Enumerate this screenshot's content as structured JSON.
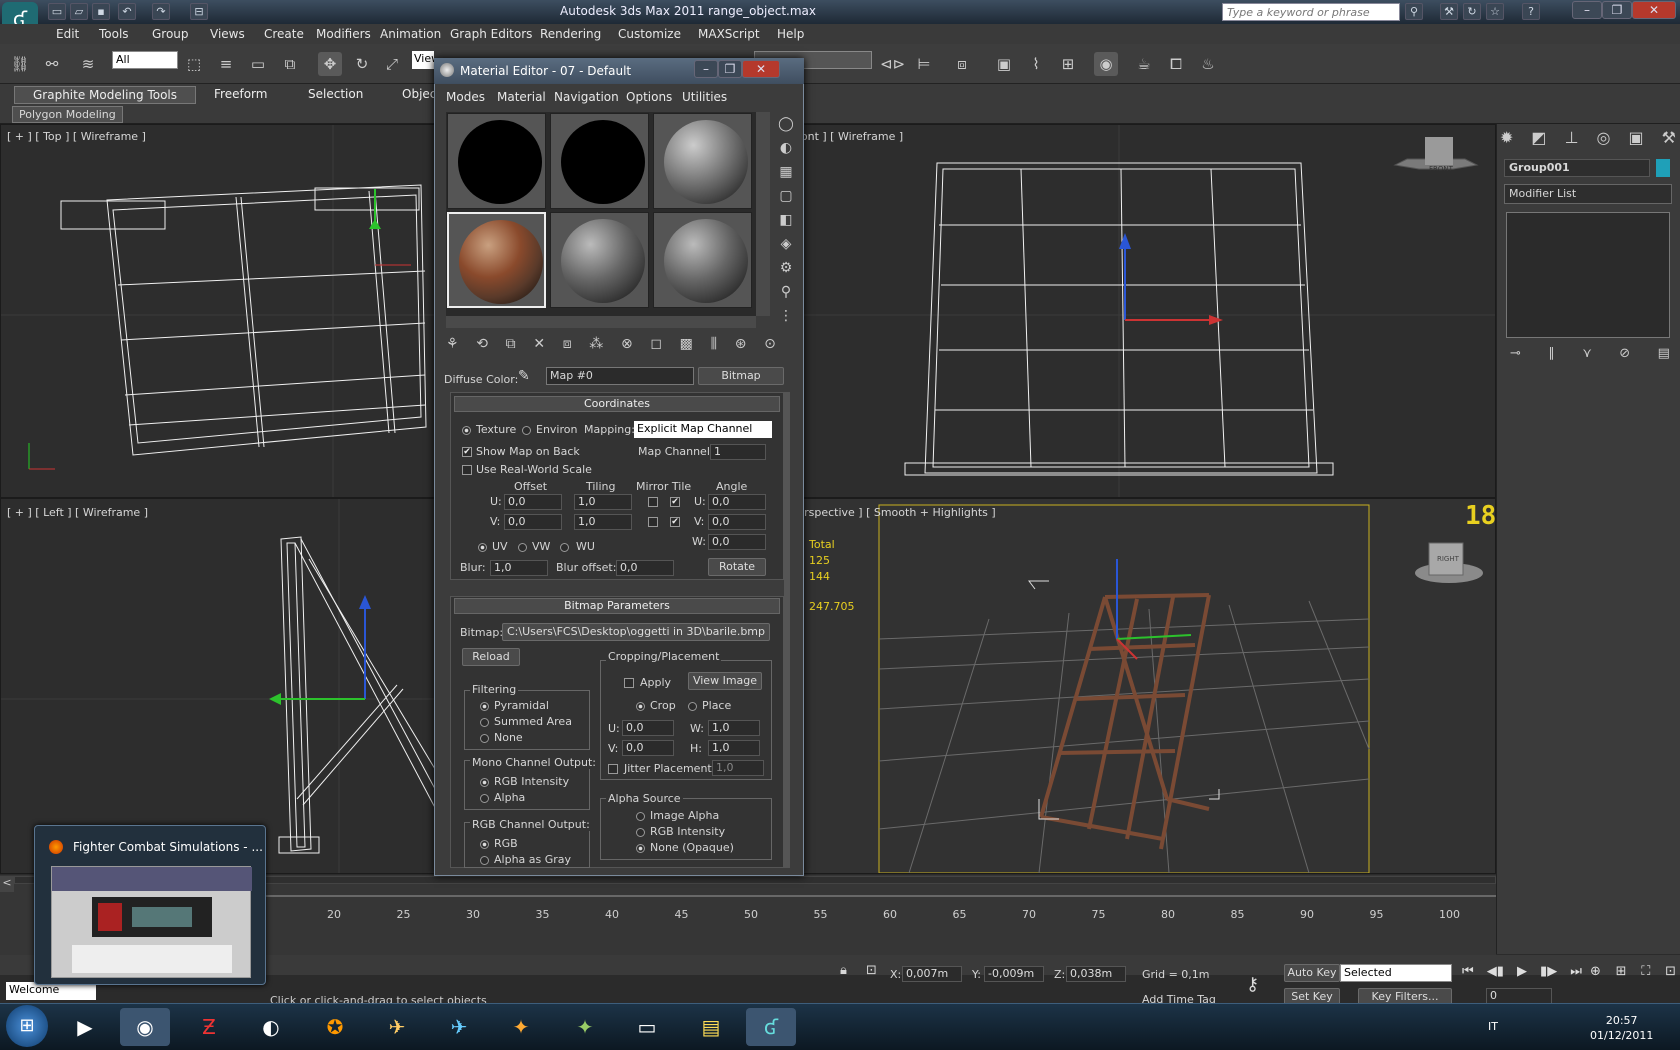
{
  "window": {
    "title": "Autodesk 3ds Max  2011      range_object.max",
    "search_placeholder": "Type a keyword or phrase"
  },
  "menubar": [
    "Edit",
    "Tools",
    "Group",
    "Views",
    "Create",
    "Modifiers",
    "Animation",
    "Graph Editors",
    "Rendering",
    "Customize",
    "MAXScript",
    "Help"
  ],
  "toolbar": {
    "selection_filter": "All",
    "view": "View"
  },
  "ribbon": {
    "tabs": [
      "Graphite Modeling Tools",
      "Freeform",
      "Selection",
      "Object"
    ],
    "sub": "Polygon Modeling"
  },
  "viewports": {
    "top": "[ + ] [ Top ] [ Wireframe ]",
    "front": "[ + ] [ Front ] [ Wireframe ]",
    "left": "[ + ] [ Left ] [ Wireframe ]",
    "persp": "[ + ] [ Perspective ] [ Smooth + Highlights ]",
    "stats": [
      "Total",
      "125",
      "144",
      "247.705"
    ],
    "fps": "18",
    "viewcube_front": "FRONT",
    "viewcube_right": "RIGHT"
  },
  "command_panel": {
    "object_name": "Group001",
    "modifier_list": "Modifier List"
  },
  "timeline": {
    "ticks": [
      "20",
      "25",
      "30",
      "35",
      "40",
      "45",
      "50",
      "55",
      "60",
      "65",
      "70",
      "75",
      "80",
      "85",
      "90",
      "95",
      "100"
    ],
    "arrow": "<"
  },
  "status": {
    "x_label": "X:",
    "x": "0,007m",
    "y_label": "Y:",
    "y": "-0,009m",
    "z_label": "Z:",
    "z": "0,038m",
    "grid": "Grid = 0,1m",
    "auto_key": "Auto Key",
    "selected": "Selected",
    "set_key": "Set Key",
    "key_filters": "Key Filters...",
    "add_time_tag": "Add Time Tag",
    "frame": "0",
    "prompt": "Click or click-and-drag to select objects",
    "welcome": "Welcome"
  },
  "material_editor": {
    "title": "Material Editor - 07 - Default",
    "menu": [
      "Modes",
      "Material",
      "Navigation",
      "Options",
      "Utilities"
    ],
    "diffuse_label": "Diffuse Color:",
    "map_name": "Map #0",
    "map_type": "Bitmap",
    "coordinates": {
      "header": "Coordinates",
      "texture": "Texture",
      "environ": "Environ",
      "mapping_label": "Mapping:",
      "mapping": "Explicit Map Channel",
      "show_map_on_back": "Show Map on Back",
      "map_channel_label": "Map Channel:",
      "map_channel": "1",
      "real_world": "Use Real-World Scale",
      "offset": "Offset",
      "tiling": "Tiling",
      "mirror_tile": "Mirror Tile",
      "angle": "Angle",
      "u_label": "U:",
      "v_label": "V:",
      "w_label": "W:",
      "u_offset": "0,0",
      "v_offset": "0,0",
      "u_tiling": "1,0",
      "v_tiling": "1,0",
      "u_angle": "0,0",
      "v_angle": "0,0",
      "w_angle": "0,0",
      "uv": "UV",
      "vw": "VW",
      "wu": "WU",
      "blur_label": "Blur:",
      "blur": "1,0",
      "blur_offset_label": "Blur offset:",
      "blur_offset": "0,0",
      "rotate": "Rotate"
    },
    "bitmap_params": {
      "header": "Bitmap Parameters",
      "bitmap_label": "Bitmap:",
      "path": "C:\\Users\\FCS\\Desktop\\oggetti in 3D\\barile.bmp",
      "reload": "Reload",
      "cropping": "Cropping/Placement",
      "apply": "Apply",
      "view_image": "View Image",
      "crop": "Crop",
      "place": "Place",
      "u_val": "0,0",
      "w_val": "1,0",
      "v_val": "0,0",
      "h_val": "1,0",
      "h_label": "H:",
      "jitter": "Jitter Placement:",
      "jitter_val": "1,0",
      "filtering": "Filtering",
      "pyramidal": "Pyramidal",
      "summed": "Summed Area",
      "none": "None",
      "mono": "Mono Channel Output:",
      "rgb_int": "RGB Intensity",
      "alpha": "Alpha",
      "rgb_out": "RGB Channel Output:",
      "rgb": "RGB",
      "alpha_gray": "Alpha as Gray",
      "alpha_source": "Alpha Source",
      "image_alpha": "Image Alpha",
      "rgb_intensity": "RGB Intensity",
      "none_opaque": "None (Opaque)"
    }
  },
  "taskbar_preview": {
    "title": "Fighter Combat Simulations - ..."
  },
  "clock": {
    "time": "20:57",
    "date": "01/12/2011",
    "lang": "IT"
  }
}
